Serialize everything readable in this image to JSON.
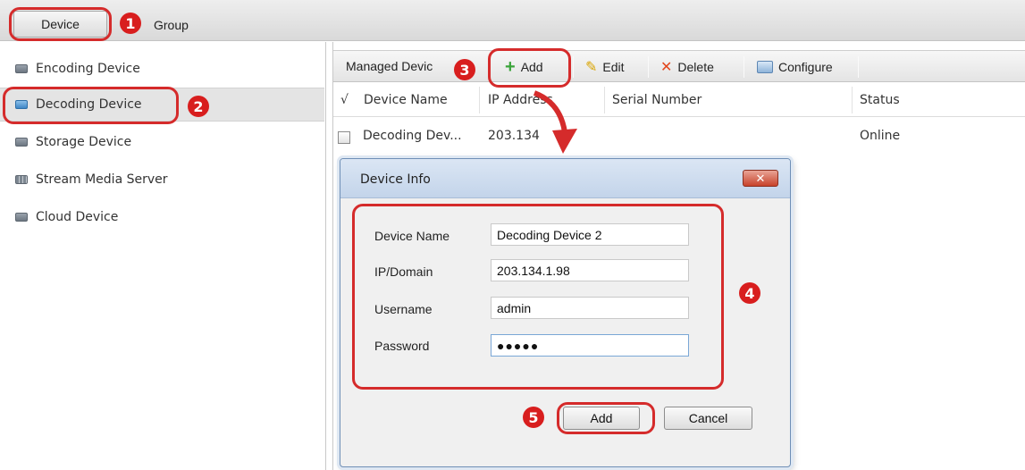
{
  "tabs": {
    "device": "Device",
    "group": "Group"
  },
  "sidebar": {
    "items": [
      {
        "label": "Encoding Device"
      },
      {
        "label": "Decoding Device"
      },
      {
        "label": "Storage Device"
      },
      {
        "label": "Stream Media Server"
      },
      {
        "label": "Cloud Device"
      }
    ]
  },
  "toolbar": {
    "title": "Managed Devic",
    "add": "Add",
    "edit": "Edit",
    "delete": "Delete",
    "configure": "Configure"
  },
  "table": {
    "columns": [
      "√",
      "Device Name",
      "IP Address",
      "Serial Number",
      "Status"
    ],
    "rows": [
      {
        "name": "Decoding Dev...",
        "ip": "203.134",
        "serial": "",
        "status": "Online"
      }
    ]
  },
  "dialog": {
    "title": "Device Info",
    "close": "✕",
    "fields": {
      "device_name": {
        "label": "Device Name",
        "value": "Decoding Device 2"
      },
      "ip_domain": {
        "label": "IP/Domain",
        "value": "203.134.1.98"
      },
      "username": {
        "label": "Username",
        "value": "admin"
      },
      "password": {
        "label": "Password",
        "value": "●●●●●"
      }
    },
    "add": "Add",
    "cancel": "Cancel"
  },
  "callouts": [
    "1",
    "2",
    "3",
    "4",
    "5"
  ],
  "colors": {
    "callout": "#d52b2b",
    "accent": "#3aa43a"
  }
}
